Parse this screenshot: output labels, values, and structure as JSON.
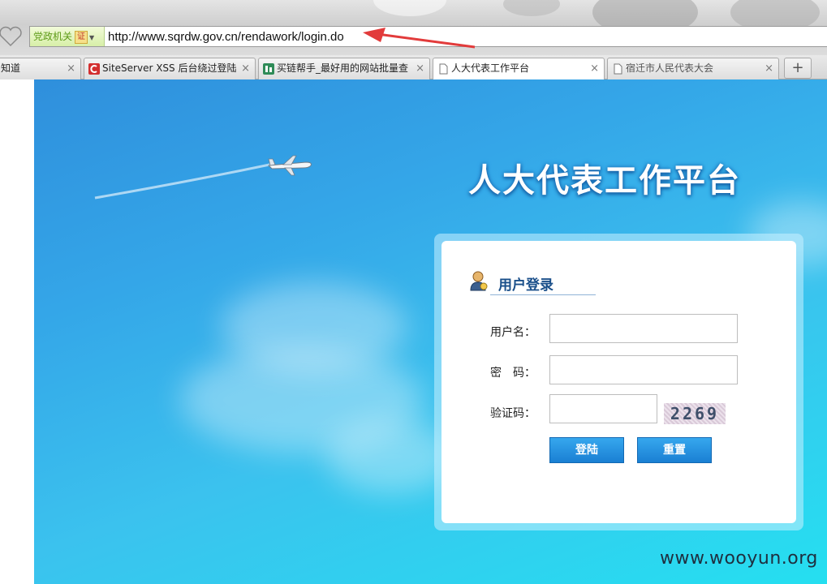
{
  "browser": {
    "address_bar": {
      "cert_label": "党政机关",
      "cert_mark": "证",
      "url": "http://www.sqrdw.gov.cn/rendawork/login.do"
    },
    "tabs": [
      {
        "title": "知道",
        "active": false
      },
      {
        "title": "SiteServer XSS 后台绕过登陆 ",
        "active": false
      },
      {
        "title": "买链帮手_最好用的网站批量查",
        "active": false
      },
      {
        "title": "人大代表工作平台",
        "active": true
      },
      {
        "title": "宿迁市人民代表大会",
        "active": false
      }
    ],
    "new_tab_label": "+",
    "close_glyph": "×"
  },
  "page": {
    "site_title": "人大代表工作平台",
    "login": {
      "header": "用户登录",
      "username_label": "用户名：",
      "password_label": "密　码：",
      "captcha_label": "验证码：",
      "captcha_text": "2269",
      "login_button": "登陆",
      "reset_button": "重置"
    }
  },
  "watermark": "www.wooyun.org",
  "colors": {
    "accent_blue": "#1a7fd3",
    "annotation_red": "#e23b3b"
  }
}
